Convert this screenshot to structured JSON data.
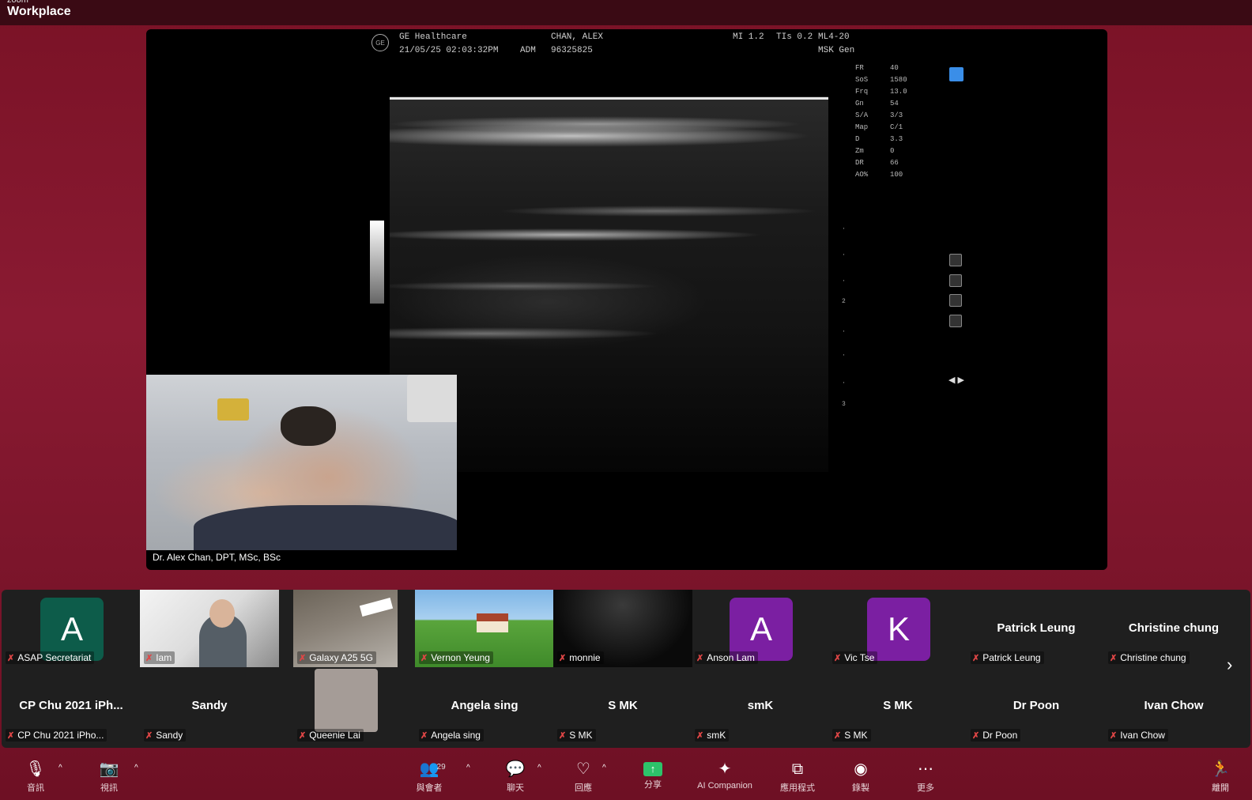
{
  "app": {
    "brand_small": "zoom",
    "brand": "Workplace"
  },
  "ultrasound": {
    "vendor": "GE Healthcare",
    "datetime": "21/05/25 02:03:32PM",
    "adm_label": "ADM",
    "patient": "CHAN, ALEX",
    "patient_id": "96325825",
    "mi": "MI 1.2",
    "tis": "TIs 0.2",
    "probe": "ML4-20",
    "preset": "MSK Gen",
    "params": [
      {
        "k": "FR",
        "v": "40"
      },
      {
        "k": "SoS",
        "v": "1580"
      },
      {
        "k": "",
        "v": ""
      },
      {
        "k": "",
        "v": ""
      },
      {
        "k": "Frq",
        "v": "13.0"
      },
      {
        "k": "Gn",
        "v": "54"
      },
      {
        "k": "S/A",
        "v": "3/3"
      },
      {
        "k": "Map",
        "v": "C/1"
      },
      {
        "k": "D",
        "v": "3.3"
      },
      {
        "k": "Zm",
        "v": "0"
      },
      {
        "k": "DR",
        "v": "66"
      },
      {
        "k": "AO%",
        "v": "100"
      }
    ],
    "depth_marks": [
      "2",
      "3"
    ]
  },
  "presenter": {
    "name": "Dr. Alex Chan, DPT, MSc, BSc"
  },
  "gallery": {
    "row1": [
      {
        "name": "ASAP Secretariat",
        "avatar": "A",
        "avatar_color": "#0d5c4a"
      },
      {
        "name": "Iam"
      },
      {
        "name": "Galaxy A25 5G"
      },
      {
        "name": "Vernon Yeung"
      },
      {
        "name": "monnie"
      },
      {
        "name": "Anson Lam",
        "avatar": "A",
        "avatar_color": "#7b1fa2"
      },
      {
        "name": "Vic Tse",
        "avatar": "K",
        "avatar_color": "#7b1fa2"
      },
      {
        "name": "Patrick Leung",
        "big": "Patrick Leung"
      },
      {
        "name": "Christine chung",
        "big": "Christine chung"
      }
    ],
    "row2": [
      {
        "name": "CP Chu 2021 iPho...",
        "big": "CP Chu 2021 iPh..."
      },
      {
        "name": "Sandy",
        "big": "Sandy"
      },
      {
        "name": "Queenie Lai"
      },
      {
        "name": "Angela sing",
        "big": "Angela sing"
      },
      {
        "name": "S MK",
        "big": "S MK"
      },
      {
        "name": "smK",
        "big": "smK"
      },
      {
        "name": "S MK",
        "big": "S MK"
      },
      {
        "name": "Dr Poon",
        "big": "Dr Poon"
      },
      {
        "name": "Ivan Chow",
        "big": "Ivan Chow"
      }
    ]
  },
  "toolbar": {
    "audio": "音訊",
    "video": "視訊",
    "participants": "與會者",
    "participants_count": "29",
    "chat": "聊天",
    "react": "回應",
    "share": "分享",
    "ai": "AI Companion",
    "apps": "應用程式",
    "record": "錄製",
    "more": "更多",
    "leave": "離開"
  }
}
